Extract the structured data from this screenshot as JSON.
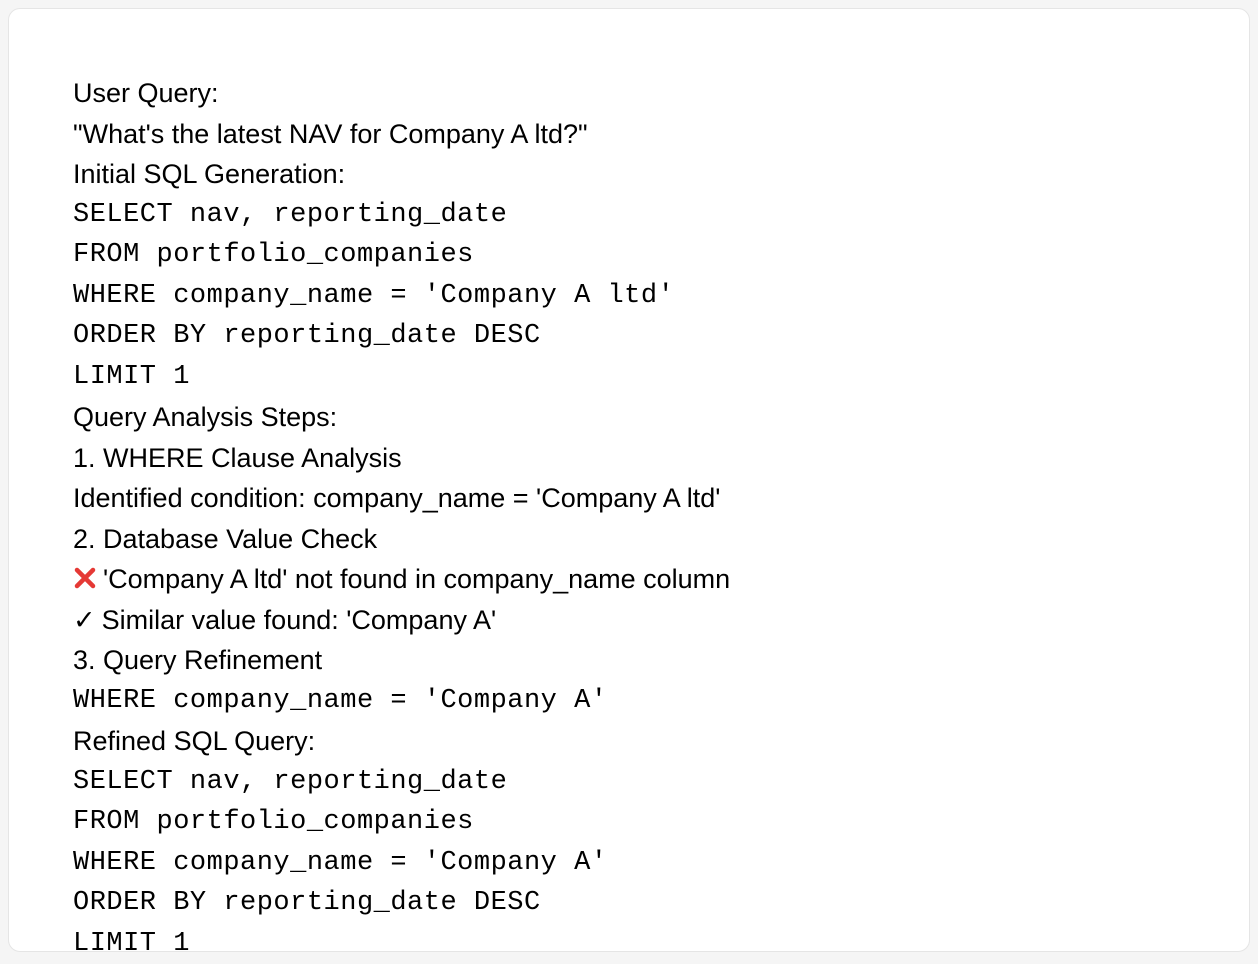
{
  "section_user_query": {
    "label": "User Query:",
    "text": "\"What's the latest NAV for Company A ltd?\""
  },
  "section_initial_sql": {
    "label": "Initial SQL Generation:",
    "lines": [
      "SELECT nav, reporting_date",
      "FROM portfolio_companies",
      "WHERE company_name = 'Company A ltd'",
      "ORDER BY reporting_date DESC",
      "LIMIT 1"
    ]
  },
  "section_analysis": {
    "label": "Query Analysis Steps:",
    "step1": {
      "title": "1. WHERE Clause Analysis",
      "detail": "Identified condition: company_name = 'Company A ltd'"
    },
    "step2": {
      "title": "2. Database Value Check",
      "not_found": "'Company A ltd' not found in company_name column",
      "found": "Similar value found: 'Company A'"
    },
    "step3": {
      "title": "3. Query Refinement",
      "code": "WHERE company_name = 'Company A'"
    }
  },
  "section_refined_sql": {
    "label": "Refined SQL Query:",
    "lines": [
      "SELECT nav, reporting_date",
      "FROM portfolio_companies",
      "WHERE company_name = 'Company A'",
      "ORDER BY reporting_date DESC",
      "LIMIT 1"
    ]
  },
  "icons": {
    "x_color": "#E53935",
    "check_glyph": "✓"
  }
}
